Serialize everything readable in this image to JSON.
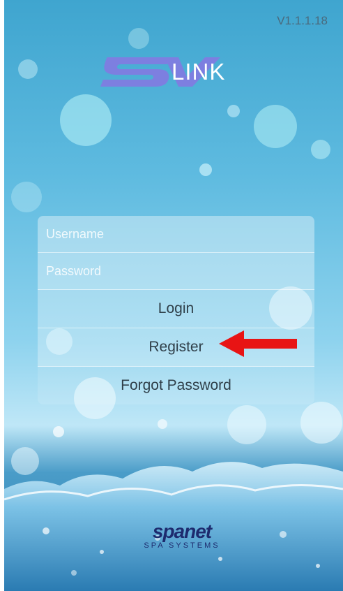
{
  "version": "V1.1.1.18",
  "logo": {
    "text": "LINK"
  },
  "login_form": {
    "username_placeholder": "Username",
    "password_placeholder": "Password",
    "login_label": "Login",
    "register_label": "Register",
    "forgot_password_label": "Forgot Password"
  },
  "annotation": {
    "arrow_color": "#e81414"
  },
  "footer": {
    "brand": "spanet",
    "tagline": "SPA SYSTEMS"
  },
  "colors": {
    "brand_navy": "#1d2b6e",
    "logo_purple": "#7d7fe0",
    "sky_blue": "#5fbbe0"
  }
}
